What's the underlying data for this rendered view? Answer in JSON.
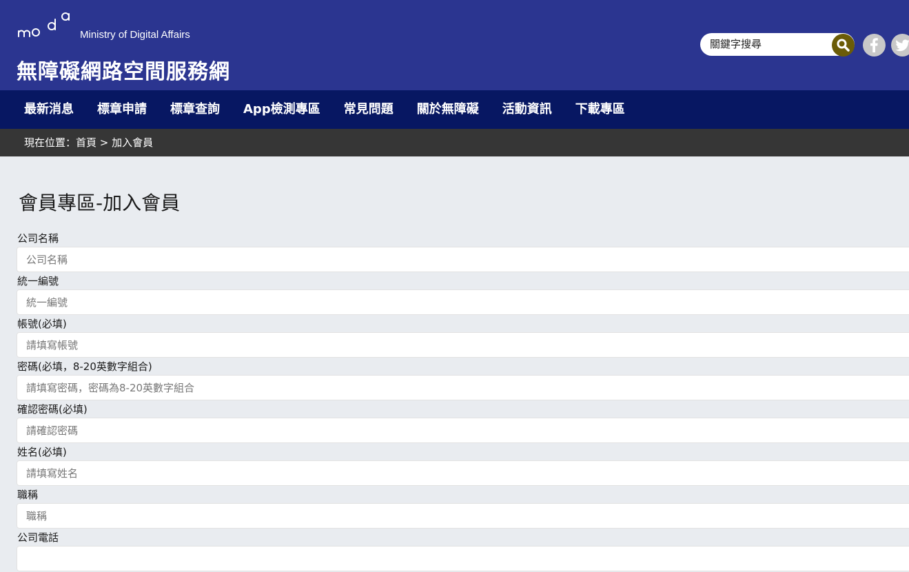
{
  "header": {
    "logo_text": "Ministry of Digital Affairs",
    "site_title": "無障礙網路空間服務網",
    "search_placeholder": "關鍵字搜尋",
    "colors": {
      "header_bg": "#2b3590",
      "nav_bg": "#071762",
      "breadcrumb_bg": "#363636",
      "search_button": "#6b5c07"
    },
    "social_icons": [
      "facebook-icon",
      "twitter-icon"
    ]
  },
  "nav": {
    "items": [
      {
        "label": "最新消息"
      },
      {
        "label": "標章申請"
      },
      {
        "label": "標章查詢"
      },
      {
        "label": "App檢測專區"
      },
      {
        "label": "常見問題"
      },
      {
        "label": "關於無障礙"
      },
      {
        "label": "活動資訊"
      },
      {
        "label": "下載專區"
      }
    ]
  },
  "breadcrumb": {
    "prefix": "現在位置：",
    "home": "首頁",
    "separator": " > ",
    "current": "加入會員"
  },
  "main": {
    "page_title": "會員專區-加入會員",
    "fields": [
      {
        "label": "公司名稱",
        "placeholder": "公司名稱",
        "value": ""
      },
      {
        "label": "統一編號",
        "placeholder": "統一編號",
        "value": ""
      },
      {
        "label": "帳號(必填)",
        "placeholder": "請填寫帳號",
        "value": ""
      },
      {
        "label": "密碼(必填，8-20英數字組合)",
        "placeholder": "請填寫密碼，密碼為8-20英數字組合",
        "value": ""
      },
      {
        "label": "確認密碼(必填)",
        "placeholder": "請確認密碼",
        "value": ""
      },
      {
        "label": "姓名(必填)",
        "placeholder": "請填寫姓名",
        "value": ""
      },
      {
        "label": "職稱",
        "placeholder": "職稱",
        "value": ""
      },
      {
        "label": "公司電話",
        "placeholder": "",
        "value": ""
      }
    ]
  }
}
